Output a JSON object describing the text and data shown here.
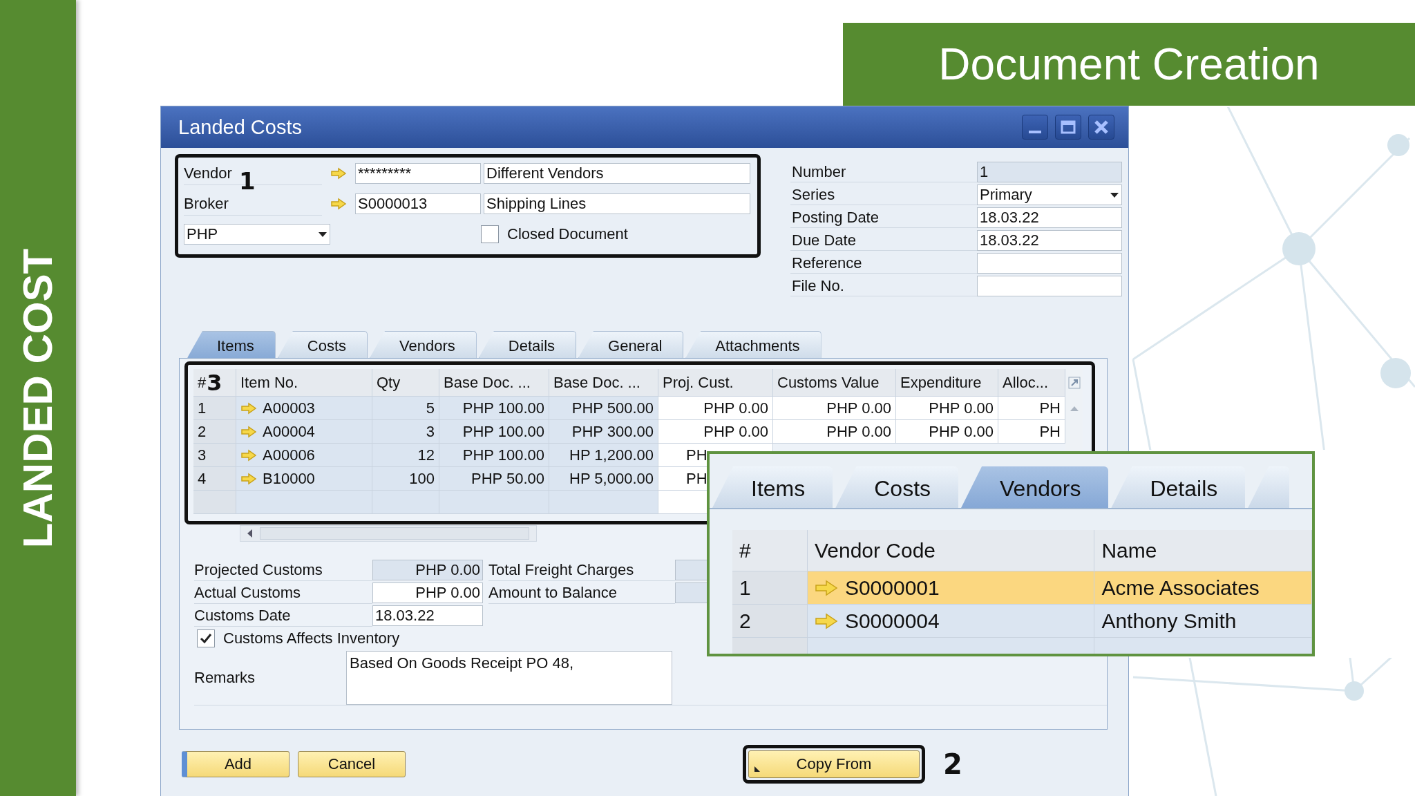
{
  "side_title": "LANDED COST",
  "banner_title": "Document Creation",
  "window": {
    "title": "Landed Costs"
  },
  "header": {
    "partners": [
      {
        "label": "Vendor",
        "code": "*********",
        "name": "Different Vendors"
      },
      {
        "label": "Broker",
        "code": "S0000013",
        "name": "Shipping Lines"
      }
    ],
    "currency": "PHP",
    "closed_document": {
      "label": "Closed Document",
      "checked": false
    }
  },
  "document_fields": [
    {
      "label": "Number",
      "value": "1",
      "kind": "readonly"
    },
    {
      "label": "Series",
      "value": "Primary",
      "kind": "dropdown"
    },
    {
      "label": "Posting Date",
      "value": "18.03.22",
      "kind": "text"
    },
    {
      "label": "Due Date",
      "value": "18.03.22",
      "kind": "text"
    },
    {
      "label": "Reference",
      "kind": "text"
    },
    {
      "label": "File No.",
      "kind": "text"
    }
  ],
  "tabs": [
    {
      "label": "Items",
      "selected": true
    },
    {
      "label": "Costs",
      "selected": false
    },
    {
      "label": "Vendors",
      "selected": false
    },
    {
      "label": "Details",
      "selected": false
    },
    {
      "label": "General",
      "selected": false
    },
    {
      "label": "Attachments",
      "selected": false
    }
  ],
  "items_table": {
    "columns": [
      {
        "label": "#",
        "kind": "index"
      },
      {
        "label": "Item No.",
        "kind": "link"
      },
      {
        "label": "Qty",
        "kind": "readonly"
      },
      {
        "label": "Base Doc. ...",
        "kind": "readonly"
      },
      {
        "label": "Base Doc. ...",
        "kind": "readonly"
      },
      {
        "label": "Proj. Cust.",
        "kind": "editable"
      },
      {
        "label": "Customs Value",
        "kind": "editable"
      },
      {
        "label": "Expenditure",
        "kind": "editable"
      },
      {
        "label": "Alloc...",
        "kind": "editable"
      }
    ],
    "rows": [
      {
        "cells": [
          "1",
          "A00003",
          "5",
          "PHP 100.00",
          "PHP 500.00",
          "PHP 0.00",
          "PHP 0.00",
          "PHP 0.00",
          "PH"
        ]
      },
      {
        "cells": [
          "2",
          "A00004",
          "3",
          "PHP 100.00",
          "PHP 300.00",
          "PHP 0.00",
          "PHP 0.00",
          "PHP 0.00",
          "PH"
        ]
      },
      {
        "cells": [
          "3",
          "A00006",
          "12",
          "PHP 100.00",
          "HP 1,200.00",
          "PH"
        ]
      },
      {
        "cells": [
          "4",
          "B10000",
          "100",
          "PHP 50.00",
          "HP 5,000.00",
          "PH"
        ]
      }
    ]
  },
  "summary": [
    {
      "label": "Projected Customs",
      "value": "PHP 0.00",
      "kind": "amount",
      "readonly": true,
      "side_label": "Total Freight Charges"
    },
    {
      "label": "Actual Customs",
      "value": "PHP 0.00",
      "kind": "amount",
      "readonly": false,
      "side_label": "Amount to Balance"
    },
    {
      "label": "Customs Date",
      "value": "18.03.22",
      "kind": "date",
      "readonly": false
    }
  ],
  "customs_affects_inventory": {
    "label": "Customs Affects Inventory",
    "checked": true
  },
  "remarks": {
    "label": "Remarks",
    "value": "Based On Goods Receipt PO 48,"
  },
  "buttons": [
    {
      "label": "Add",
      "kind": "default"
    },
    {
      "label": "Cancel",
      "kind": "normal"
    },
    {
      "label": "Copy From",
      "kind": "menu"
    }
  ],
  "annotations": [
    "1",
    "2",
    "3"
  ],
  "inset": {
    "tabs": [
      {
        "label": "Items",
        "selected": false
      },
      {
        "label": "Costs",
        "selected": false
      },
      {
        "label": "Vendors",
        "selected": true
      },
      {
        "label": "Details",
        "selected": false
      }
    ],
    "columns": [
      "#",
      "Vendor Code",
      "Name"
    ],
    "rows": [
      {
        "number": "1",
        "code": "S0000001",
        "name": "Acme Associates",
        "selected": true
      },
      {
        "number": "2",
        "code": "S0000004",
        "name": "Anthony Smith",
        "selected": false
      }
    ]
  }
}
